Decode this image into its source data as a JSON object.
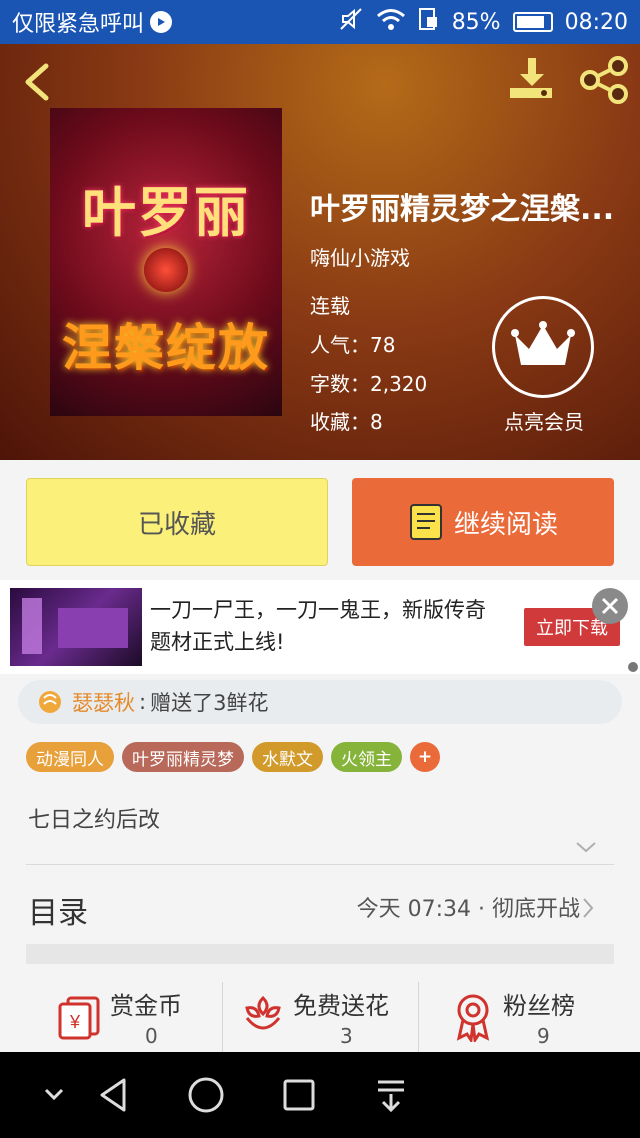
{
  "status_bar": {
    "carrier": "仅限紧急呼叫",
    "battery": "85%",
    "battery_level": 0.85,
    "time": "08:20"
  },
  "book": {
    "title": "叶罗丽精灵梦之涅槃...",
    "author": "嗨仙小游戏",
    "status": "连载",
    "popularity": "人气：78",
    "word_count": "字数：2,320",
    "favorites": "收藏：8",
    "cover_title": "叶罗丽",
    "cover_subtitle": "涅槃绽放"
  },
  "vip": {
    "label": "点亮会员"
  },
  "actions": {
    "collected": "已收藏",
    "continue_reading": "继续阅读"
  },
  "ad": {
    "text": "一刀一尸王，一刀一鬼王，新版传奇题材正式上线!",
    "button": "立即下载"
  },
  "gift": {
    "name": "瑟瑟秋",
    "separator": ":",
    "text": "赠送了3鲜花"
  },
  "tags": [
    {
      "label": "动漫同人",
      "color": "#e8a03a"
    },
    {
      "label": "叶罗丽精灵梦",
      "color": "#b8695a"
    },
    {
      "label": "水默文",
      "color": "#d19a2a"
    },
    {
      "label": "火领主",
      "color": "#86b43a"
    },
    {
      "label": "+",
      "color": "#ea6a3a"
    }
  ],
  "description": "七日之约后改",
  "toc": {
    "title": "目录",
    "latest": "今天 07:34 · 彻底开战"
  },
  "stats": [
    {
      "label": "赏金币",
      "value": "0",
      "icon": "red-envelope-icon"
    },
    {
      "label": "免费送花",
      "value": "3",
      "icon": "flower-icon"
    },
    {
      "label": "粉丝榜",
      "value": "9",
      "icon": "badge-icon"
    }
  ],
  "colors": {
    "status_bar": "#1b55b3",
    "accent": "#ea6a3a",
    "collected_btn": "#fbf07a",
    "icon_red": "#d0332d"
  }
}
